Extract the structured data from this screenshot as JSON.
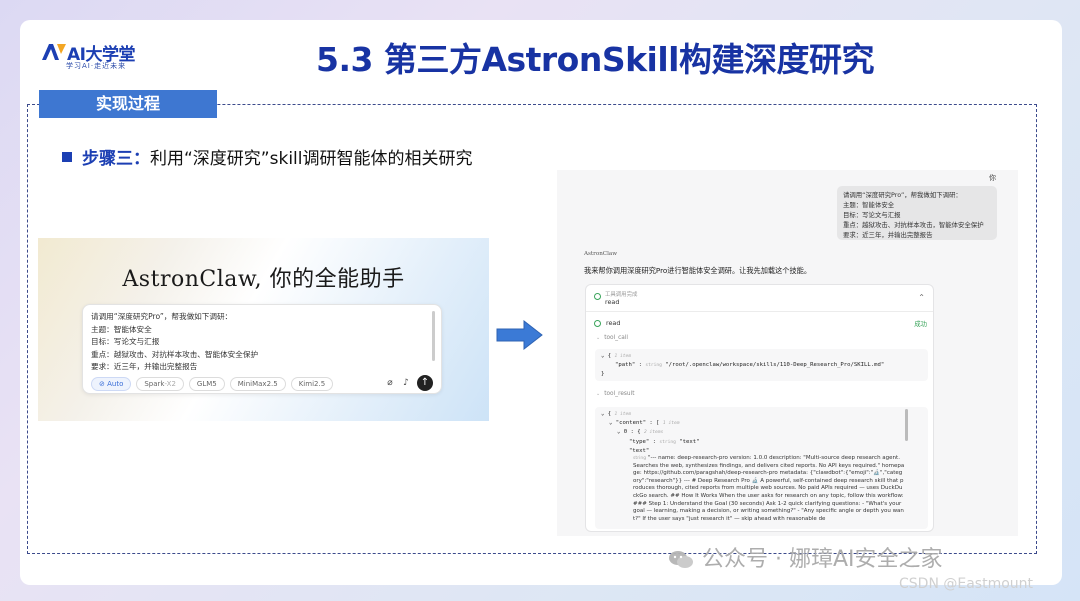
{
  "logo": {
    "main": "AI大学堂",
    "sub": "学习AI·走近未来"
  },
  "title": "5.3 第三方AstronSkill构建深度研究",
  "section_tab": "实现过程",
  "step": {
    "label": "步骤三：",
    "text": "利用“深度研究”skill调研智能体的相关研究"
  },
  "left_shot": {
    "headline": "AstronClaw, 你的全能助手",
    "prompt_lines": [
      "请调用“深度研究Pro”，帮我做如下调研：",
      "主题：智能体安全",
      "目标：写论文与汇报",
      "重点：越狱攻击、对抗样本攻击、智能体安全保护",
      "要求：近三年，并输出完整报告"
    ],
    "chips": {
      "auto": "Auto",
      "spark": "Spark",
      "spark_ver": "-X2",
      "glm": "GLM5",
      "minimax": "MiniMax2.5",
      "kimi": "Kimi2.5"
    },
    "icons": {
      "attach": "paperclip-icon",
      "mic": "mic-icon",
      "send": "send-arrow-icon"
    }
  },
  "right_shot": {
    "top_name": "你",
    "user_lines": [
      "请调用“深度研究Pro”，帮我做如下调研：",
      "主题：智能体安全",
      "目标：写论文与汇报",
      "重点：越狱攻击、对抗样本攻击，智能体安全保护",
      "要求：近三年，并输出完整报告"
    ],
    "agent_name": "AstronClaw",
    "reply": "我来帮你调用深度研究Pro进行智能体安全调研。让我先加载这个技能。",
    "card_header_small": "工具调用完成",
    "card_header_main": "read",
    "read_label": "read",
    "success_label": "成功",
    "tool_call_label": "tool_call",
    "tool_result_label": "tool_result",
    "call_items_note": "1 item",
    "path_key": "\"path\"",
    "path_type": "string",
    "path_value": "\"/root/.openclaw/workspace/skills/110-Deep_Research_Pro/SKILL.md\"",
    "result_items_note": "1 item",
    "content_key": "\"content\"",
    "content_note": "1 item",
    "item0_note": "2 items",
    "type_key": "\"type\"",
    "type_type": "string",
    "type_value": "\"text\"",
    "text_key": "\"text\"",
    "text_type": "string",
    "text_value": "\"--- name: deep-research-pro version: 1.0.0 description: \"Multi-source deep research agent. Searches the web, synthesizes findings, and delivers cited reports. No API keys required.\" homepage: https://github.com/paragshah/deep-research-pro metadata: {\"clawdbot\":{\"emoji\":\"🔬\",\"category\":\"research\"}} --- # Deep Research Pro 🔬 A powerful, self-contained deep research skill that produces thorough, cited reports from multiple web sources. No paid APIs required — uses DuckDuckGo search. ## How It Works When the user asks for research on any topic, follow this workflow: ### Step 1: Understand the Goal (30 seconds) Ask 1-2 quick clarifying questions: - \"What's your goal — learning, making a decision, or writing something?\" - \"Any specific angle or depth you want?\" If the user says \"just research it\" — skip ahead with reasonable de"
  },
  "watermarks": {
    "public_account": "公众号 · 娜璋AI安全之家",
    "csdn": "CSDN @Eastmount"
  },
  "colors": {
    "brand": "#1833a3",
    "tab": "#3e77d1",
    "success": "#3aa45b",
    "arrow": "#3b7ad6"
  }
}
